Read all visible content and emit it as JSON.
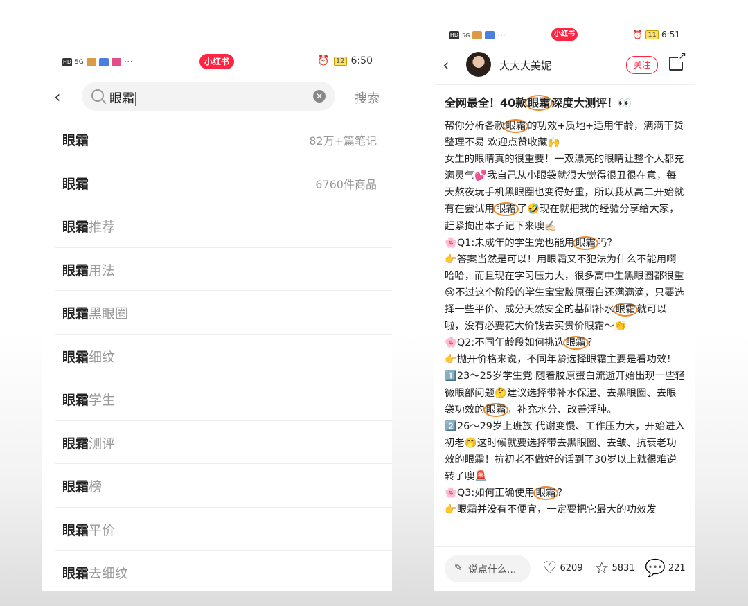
{
  "left": {
    "status": {
      "time": "6:50",
      "battery": "12",
      "network": "5G",
      "brand": "小红书"
    },
    "search": {
      "value": "眼霜",
      "button": "搜索"
    },
    "suggestions": [
      {
        "keyword": "眼霜",
        "suffix": "",
        "meta": "82万+篇笔记"
      },
      {
        "keyword": "眼霜",
        "suffix": "",
        "meta": "6760件商品"
      },
      {
        "keyword": "眼霜",
        "suffix": "推荐",
        "meta": ""
      },
      {
        "keyword": "眼霜",
        "suffix": "用法",
        "meta": ""
      },
      {
        "keyword": "眼霜",
        "suffix": "黑眼圈",
        "meta": ""
      },
      {
        "keyword": "眼霜",
        "suffix": "细纹",
        "meta": ""
      },
      {
        "keyword": "眼霜",
        "suffix": "学生",
        "meta": ""
      },
      {
        "keyword": "眼霜",
        "suffix": "测评",
        "meta": ""
      },
      {
        "keyword": "眼霜",
        "suffix": "榜",
        "meta": ""
      },
      {
        "keyword": "眼霜",
        "suffix": "平价",
        "meta": ""
      },
      {
        "keyword": "眼霜",
        "suffix": "去细纹",
        "meta": ""
      }
    ]
  },
  "right": {
    "status": {
      "time": "6:51",
      "battery": "11",
      "network": "5G",
      "brand": "小红书"
    },
    "header": {
      "author": "大大大美妮",
      "follow": "关注"
    },
    "note": {
      "title": [
        "全网最全！40款",
        "眼霜",
        "深度大测评！👀"
      ],
      "paragraphs": [
        [
          "帮你分析各款",
          "眼霜",
          "的功效+质地+适用年龄，满满干货整理不易 欢迎点赞收藏🙌"
        ],
        [
          "女生的眼睛真的很重要！一双漂亮的眼睛让整个人都充满灵气💕我自己从小眼袋就很大觉得很丑很在意，每天熬夜玩手机黑眼圈也变得好重，所以我从高二开始就有在尝试用",
          "眼霜",
          "了🤣现在就把我的经验分享给大家，赶紧掏出本子记下来噢✍🏻"
        ],
        [
          "🌸Q1:未成年的学生党也能用",
          "眼霜",
          "吗？"
        ],
        [
          "👉答案当然是可以！用眼霜又不犯法为什么不能用啊哈哈，而且现在学习压力大，很多高中生黑眼圈都很重😢不过这个阶段的学生宝宝胶原蛋白还满满滴，只要选择一些平价、成分天然安全的基础补水",
          "眼霜",
          "就可以啦，没有必要花大价钱去买贵价眼霜～👏"
        ],
        [
          "🌸Q2:不同年龄段如何挑选",
          "眼霜",
          "？"
        ],
        [
          "👉抛开价格来说，不同年龄选择眼霜主要是看功效！",
          "",
          ""
        ],
        [
          "1️⃣23～25岁学生党 随着胶原蛋白流逝开始出现一些轻微眼部问题🤔建议选择带补水保湿、去黑眼圈、去眼袋功效的",
          "眼霜",
          "，补充水分、改善浮肿。"
        ],
        [
          "2️⃣26～29岁上班族 代谢变慢、工作压力大，开始进入初老🤭这时候就要选择带去黑眼圈、去皱、抗衰老功效的眼霜！抗初老不做好的话到了30岁以上就很难逆转了噢🚨",
          "",
          ""
        ],
        [
          "🌸Q3:如何正确使用",
          "眼霜",
          "？"
        ],
        [
          "👉眼霜并没有不便宜，一定要把它最大的功效发",
          "",
          ""
        ]
      ]
    },
    "bottom": {
      "comment_placeholder": "说点什么...",
      "likes": "6209",
      "collects": "5831",
      "comments": "221"
    }
  },
  "colors": {
    "brand": "#ff2442",
    "highlight_circle": "#f08a2b"
  }
}
